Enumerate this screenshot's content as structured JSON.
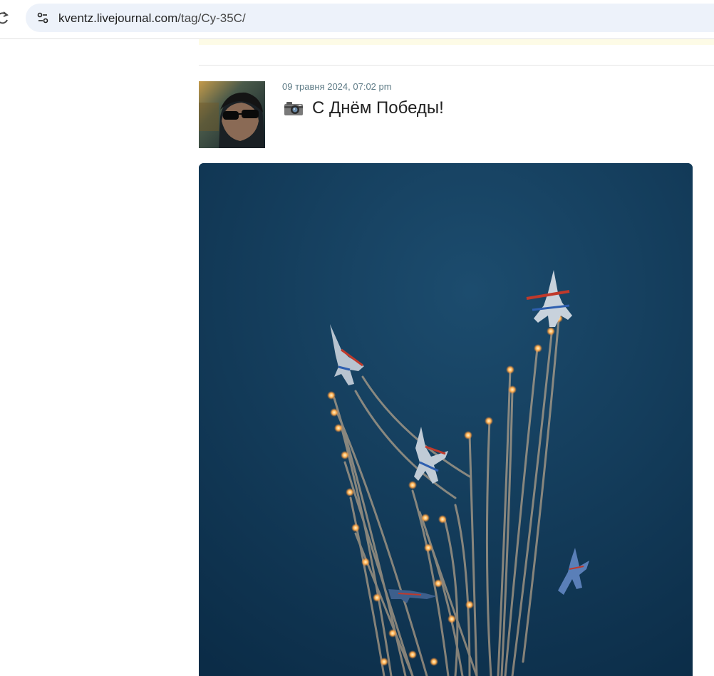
{
  "browser": {
    "url_host": "kventz.livejournal.com",
    "url_path": "/tag/Су-35С/"
  },
  "post": {
    "date": "09 травня 2024, 07:02 pm",
    "title": "С Днём Победы!"
  },
  "colors": {
    "sky": "#0f3350",
    "omnibox": "#edf2fa",
    "date_text": "#5e7b86"
  },
  "icons": {
    "reload": "reload-icon",
    "site_info": "tune-icon",
    "camera": "camera-icon"
  }
}
